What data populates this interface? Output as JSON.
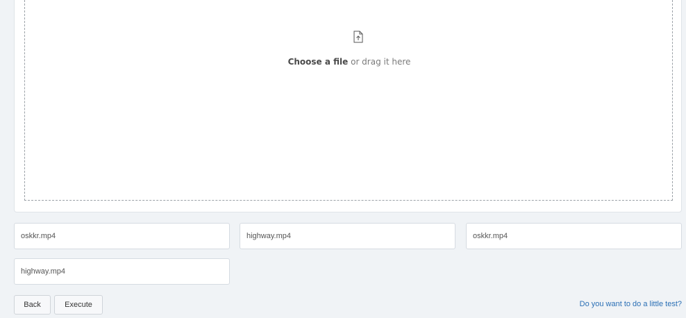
{
  "dropzone": {
    "icon": "file-upload-icon",
    "choose_label": "Choose a file",
    "drag_label": " or drag it here"
  },
  "files": [
    "oskkr.mp4",
    "highway.mp4",
    "oskkr.mp4",
    "highway.mp4"
  ],
  "actions": {
    "back_label": "Back",
    "execute_label": "Execute",
    "test_link": "Do you want to do a little test?"
  },
  "colors": {
    "page_background": "#f0f3f6",
    "link": "#2a6fb5",
    "dropzone_border": "#9aa0a6"
  }
}
